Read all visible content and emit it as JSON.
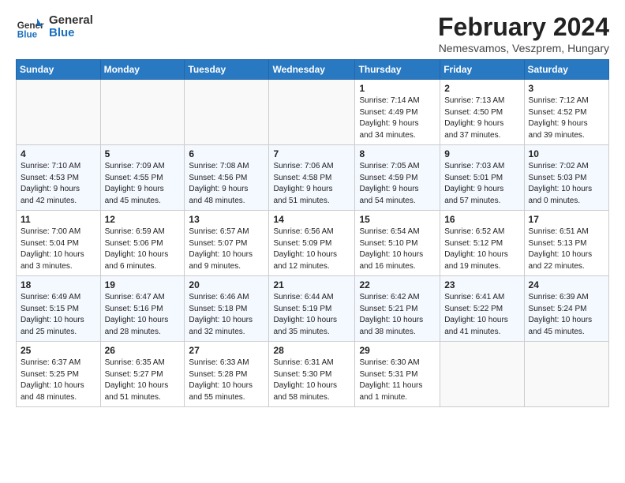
{
  "header": {
    "logo_line1": "General",
    "logo_line2": "Blue",
    "month_title": "February 2024",
    "location": "Nemesvamos, Veszprem, Hungary"
  },
  "days_of_week": [
    "Sunday",
    "Monday",
    "Tuesday",
    "Wednesday",
    "Thursday",
    "Friday",
    "Saturday"
  ],
  "weeks": [
    [
      {
        "num": "",
        "info": ""
      },
      {
        "num": "",
        "info": ""
      },
      {
        "num": "",
        "info": ""
      },
      {
        "num": "",
        "info": ""
      },
      {
        "num": "1",
        "info": "Sunrise: 7:14 AM\nSunset: 4:49 PM\nDaylight: 9 hours\nand 34 minutes."
      },
      {
        "num": "2",
        "info": "Sunrise: 7:13 AM\nSunset: 4:50 PM\nDaylight: 9 hours\nand 37 minutes."
      },
      {
        "num": "3",
        "info": "Sunrise: 7:12 AM\nSunset: 4:52 PM\nDaylight: 9 hours\nand 39 minutes."
      }
    ],
    [
      {
        "num": "4",
        "info": "Sunrise: 7:10 AM\nSunset: 4:53 PM\nDaylight: 9 hours\nand 42 minutes."
      },
      {
        "num": "5",
        "info": "Sunrise: 7:09 AM\nSunset: 4:55 PM\nDaylight: 9 hours\nand 45 minutes."
      },
      {
        "num": "6",
        "info": "Sunrise: 7:08 AM\nSunset: 4:56 PM\nDaylight: 9 hours\nand 48 minutes."
      },
      {
        "num": "7",
        "info": "Sunrise: 7:06 AM\nSunset: 4:58 PM\nDaylight: 9 hours\nand 51 minutes."
      },
      {
        "num": "8",
        "info": "Sunrise: 7:05 AM\nSunset: 4:59 PM\nDaylight: 9 hours\nand 54 minutes."
      },
      {
        "num": "9",
        "info": "Sunrise: 7:03 AM\nSunset: 5:01 PM\nDaylight: 9 hours\nand 57 minutes."
      },
      {
        "num": "10",
        "info": "Sunrise: 7:02 AM\nSunset: 5:03 PM\nDaylight: 10 hours\nand 0 minutes."
      }
    ],
    [
      {
        "num": "11",
        "info": "Sunrise: 7:00 AM\nSunset: 5:04 PM\nDaylight: 10 hours\nand 3 minutes."
      },
      {
        "num": "12",
        "info": "Sunrise: 6:59 AM\nSunset: 5:06 PM\nDaylight: 10 hours\nand 6 minutes."
      },
      {
        "num": "13",
        "info": "Sunrise: 6:57 AM\nSunset: 5:07 PM\nDaylight: 10 hours\nand 9 minutes."
      },
      {
        "num": "14",
        "info": "Sunrise: 6:56 AM\nSunset: 5:09 PM\nDaylight: 10 hours\nand 12 minutes."
      },
      {
        "num": "15",
        "info": "Sunrise: 6:54 AM\nSunset: 5:10 PM\nDaylight: 10 hours\nand 16 minutes."
      },
      {
        "num": "16",
        "info": "Sunrise: 6:52 AM\nSunset: 5:12 PM\nDaylight: 10 hours\nand 19 minutes."
      },
      {
        "num": "17",
        "info": "Sunrise: 6:51 AM\nSunset: 5:13 PM\nDaylight: 10 hours\nand 22 minutes."
      }
    ],
    [
      {
        "num": "18",
        "info": "Sunrise: 6:49 AM\nSunset: 5:15 PM\nDaylight: 10 hours\nand 25 minutes."
      },
      {
        "num": "19",
        "info": "Sunrise: 6:47 AM\nSunset: 5:16 PM\nDaylight: 10 hours\nand 28 minutes."
      },
      {
        "num": "20",
        "info": "Sunrise: 6:46 AM\nSunset: 5:18 PM\nDaylight: 10 hours\nand 32 minutes."
      },
      {
        "num": "21",
        "info": "Sunrise: 6:44 AM\nSunset: 5:19 PM\nDaylight: 10 hours\nand 35 minutes."
      },
      {
        "num": "22",
        "info": "Sunrise: 6:42 AM\nSunset: 5:21 PM\nDaylight: 10 hours\nand 38 minutes."
      },
      {
        "num": "23",
        "info": "Sunrise: 6:41 AM\nSunset: 5:22 PM\nDaylight: 10 hours\nand 41 minutes."
      },
      {
        "num": "24",
        "info": "Sunrise: 6:39 AM\nSunset: 5:24 PM\nDaylight: 10 hours\nand 45 minutes."
      }
    ],
    [
      {
        "num": "25",
        "info": "Sunrise: 6:37 AM\nSunset: 5:25 PM\nDaylight: 10 hours\nand 48 minutes."
      },
      {
        "num": "26",
        "info": "Sunrise: 6:35 AM\nSunset: 5:27 PM\nDaylight: 10 hours\nand 51 minutes."
      },
      {
        "num": "27",
        "info": "Sunrise: 6:33 AM\nSunset: 5:28 PM\nDaylight: 10 hours\nand 55 minutes."
      },
      {
        "num": "28",
        "info": "Sunrise: 6:31 AM\nSunset: 5:30 PM\nDaylight: 10 hours\nand 58 minutes."
      },
      {
        "num": "29",
        "info": "Sunrise: 6:30 AM\nSunset: 5:31 PM\nDaylight: 11 hours\nand 1 minute."
      },
      {
        "num": "",
        "info": ""
      },
      {
        "num": "",
        "info": ""
      }
    ]
  ]
}
